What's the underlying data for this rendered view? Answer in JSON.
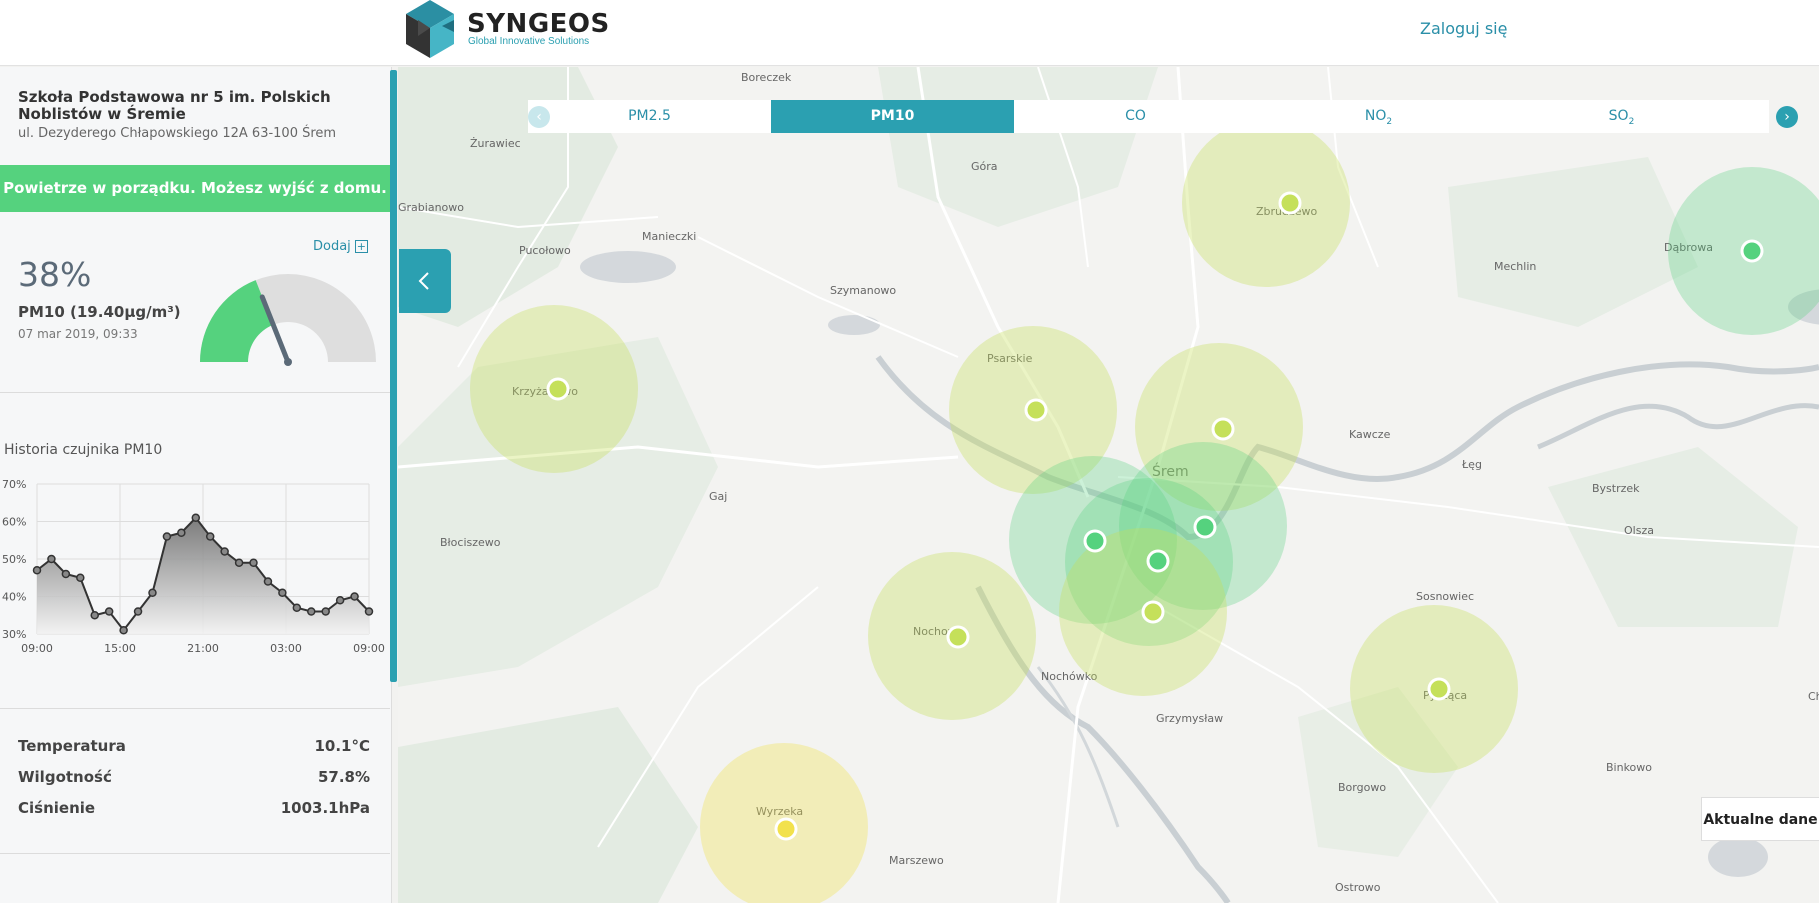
{
  "header": {
    "logo_name": "SYNGEOS",
    "logo_tagline": "Global Innovative Solutions",
    "login_label": "Zaloguj się"
  },
  "sidebar": {
    "school_name": "Szkoła Podstawowa nr 5 im. Polskich Noblistów w Śremie",
    "school_address": "ul. Dezyderego Chłapowskiego 12A 63-100 Śrem",
    "status_message": "Powietrze w porządku. Możesz wyjść z domu.",
    "add_label": "Dodaj",
    "add_icon": "+",
    "aqi_percent": "38%",
    "aqi_level": 0.38,
    "pm_label": "PM10 (19.40µg/m³)",
    "measurement_date": "07 mar 2019, 09:33",
    "history_title": "Historia czujnika PM10",
    "stats": [
      {
        "label": "Temperatura",
        "value": "10.1°C"
      },
      {
        "label": "Wilgotność",
        "value": "57.8%"
      },
      {
        "label": "Ciśnienie",
        "value": "1003.1hPa"
      }
    ]
  },
  "chart_data": {
    "type": "area",
    "title": "",
    "xlabel": "",
    "ylabel": "",
    "ylim": [
      30,
      70
    ],
    "y_ticks": [
      "70%",
      "60%",
      "50%",
      "40%",
      "30%"
    ],
    "x_ticks": [
      "09:00",
      "15:00",
      "21:00",
      "03:00",
      "09:00"
    ],
    "series": [
      {
        "values": [
          47,
          50,
          46,
          45,
          35,
          36,
          31,
          36,
          41,
          56,
          57,
          61,
          56,
          52,
          49,
          49,
          44,
          41,
          37,
          36,
          36,
          39,
          40,
          36
        ]
      }
    ]
  },
  "tabs": {
    "items": [
      "PM2.5",
      "PM10",
      "CO",
      "NO",
      "SO"
    ],
    "subscripts": [
      "",
      "",
      "",
      "2",
      "2"
    ],
    "active": "PM10",
    "prev_icon": "chevron-left-icon",
    "next_icon": "chevron-right-icon"
  },
  "map": {
    "places": [
      "Boreczek",
      "Żurawiec",
      "Góra",
      "Zbrudzewo",
      "Dąbrowa",
      "Mechlin",
      "Manieczki",
      "Pucołowo",
      "Grabianowo",
      "Szymanowo",
      "Krzyżanowo",
      "Psarskie",
      "Śrem",
      "Kawcze",
      "Łęg",
      "Bystrzek",
      "Olsza",
      "Gaj",
      "Błociszewo",
      "Nochowo",
      "Nochówko",
      "Grzymysław",
      "Sosnowiec",
      "Pysząca",
      "Binkowo",
      "Borgowo",
      "Wyrzeka",
      "Marszewo",
      "Ostrowo",
      "Ch"
    ],
    "colors": {
      "good": "#55d27e",
      "moderate": "#c5e05a",
      "fair": "#f2e14c",
      "accent": "#2ba0b1"
    }
  },
  "current_data_label": "Aktualne dane"
}
